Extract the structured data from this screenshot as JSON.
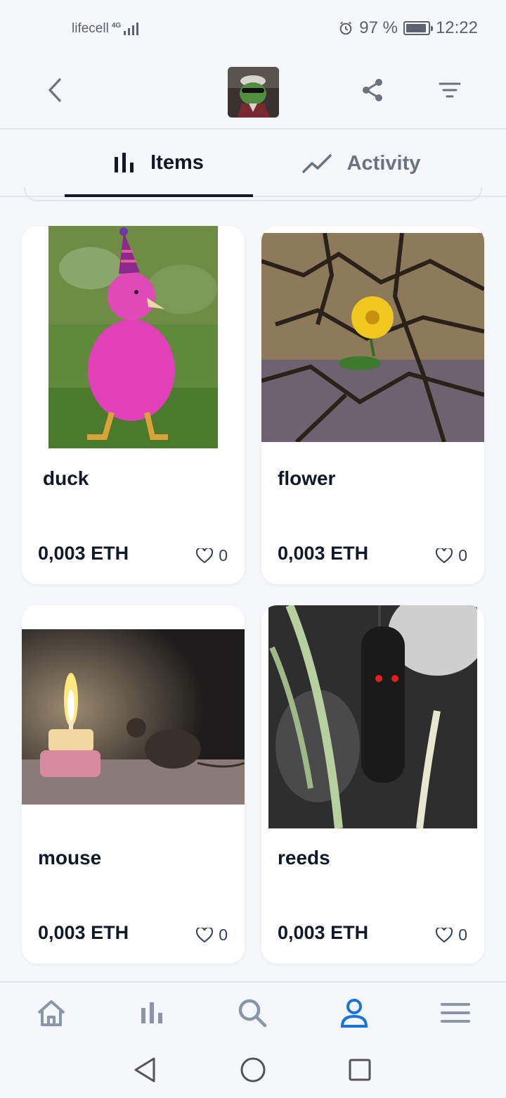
{
  "status_bar": {
    "carrier": "lifecell",
    "network": "4G",
    "battery": "97 %",
    "battery_level": 0.97,
    "time": "12:22"
  },
  "header": {
    "back_icon": "chevron-left-icon",
    "share_icon": "share-icon",
    "filter_icon": "filter-icon"
  },
  "tabs": [
    {
      "label": "Items",
      "icon": "bar-chart-icon",
      "active": true
    },
    {
      "label": "Activity",
      "icon": "trend-line-icon",
      "active": false
    }
  ],
  "items": [
    {
      "name": "duck",
      "price": "0,003 ETH",
      "likes": "0"
    },
    {
      "name": "flower",
      "price": "0,003 ETH",
      "likes": "0"
    },
    {
      "name": "mouse",
      "price": "0,003 ETH",
      "likes": "0"
    },
    {
      "name": "reeds",
      "price": "0,003 ETH",
      "likes": "0"
    }
  ],
  "bottom_nav": [
    {
      "icon": "home-icon"
    },
    {
      "icon": "stats-icon"
    },
    {
      "icon": "search-icon"
    },
    {
      "icon": "profile-icon",
      "active": true
    },
    {
      "icon": "menu-icon"
    }
  ],
  "colors": {
    "background": "#f5f7fa",
    "text": "#111827",
    "muted": "#6b7280",
    "nav_icon": "#8a96a8",
    "active_blue": "#1a73d9"
  }
}
